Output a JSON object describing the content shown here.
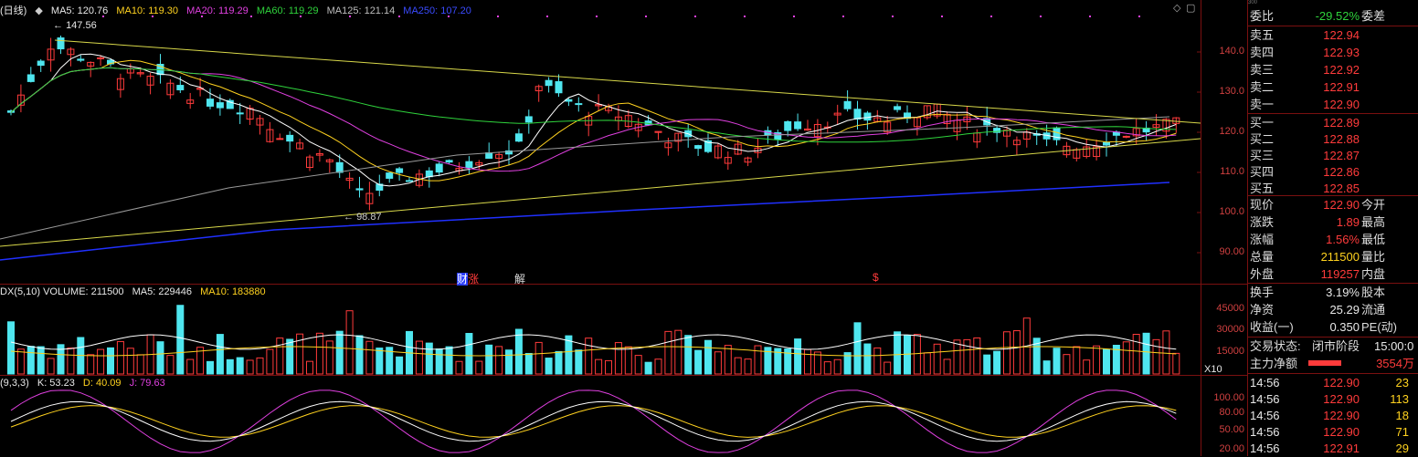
{
  "main_legend": {
    "period": "(日线)",
    "ma5": "MA5: 120.76",
    "ma10": "MA10: 119.30",
    "ma20": "MA20: 119.29",
    "ma60": "MA60: 119.29",
    "ma125": "MA125: 121.14",
    "ma250": "MA250: 107.20"
  },
  "price_axis": [
    "140.0",
    "130.0",
    "120.0",
    "110.0",
    "100.0",
    "90.00"
  ],
  "annotations": {
    "high": "147.56",
    "low": "98.87",
    "event1": "财",
    "event1b": "涨",
    "event2": "解",
    "event3": "$"
  },
  "volume_legend": {
    "name": "DX(5,10) VOLUME: 211500",
    "ma5": "MA5: 229446",
    "ma10": "MA10: 183880"
  },
  "volume_axis": [
    "45000",
    "30000",
    "15000"
  ],
  "volume_unit": "X10",
  "kdj_legend": {
    "name": "(9,3,3)",
    "k": "K: 53.23",
    "d": "D: 40.09",
    "j": "J: 79.63"
  },
  "kdj_axis": [
    "100.00",
    "80.00",
    "50.00",
    "20.00"
  ],
  "right_panel": {
    "top_code": "300",
    "weibi_label": "委比",
    "weibi_value": "-29.52%",
    "weicha_label": "委差",
    "sell": [
      {
        "label": "卖五",
        "price": "122.94"
      },
      {
        "label": "卖四",
        "price": "122.93"
      },
      {
        "label": "卖三",
        "price": "122.92"
      },
      {
        "label": "卖二",
        "price": "122.91"
      },
      {
        "label": "卖一",
        "price": "122.90"
      }
    ],
    "buy": [
      {
        "label": "买一",
        "price": "122.89"
      },
      {
        "label": "买二",
        "price": "122.88"
      },
      {
        "label": "买三",
        "price": "122.87"
      },
      {
        "label": "买四",
        "price": "122.86"
      },
      {
        "label": "买五",
        "price": "122.85"
      }
    ],
    "quote": [
      {
        "label": "现价",
        "value": "122.90",
        "label2": "今开"
      },
      {
        "label": "涨跌",
        "value": "1.89",
        "label2": "最高"
      },
      {
        "label": "涨幅",
        "value": "1.56%",
        "label2": "最低"
      },
      {
        "label": "总量",
        "value": "211500",
        "label2": "量比"
      },
      {
        "label": "外盘",
        "value": "119257",
        "label2": "内盘"
      }
    ],
    "stats": [
      {
        "label": "换手",
        "value": "3.19%",
        "label2": "股本"
      },
      {
        "label": "净资",
        "value": "25.29",
        "label2": "流通"
      },
      {
        "label": "收益(一)",
        "value": "0.350",
        "label2": "PE(动)"
      }
    ],
    "trade_status_label": "交易状态:",
    "trade_status_value": "闭市阶段",
    "trade_time": "15:00:0",
    "main_net_label": "主力净额",
    "main_net_value": "3554万",
    "ticks": [
      {
        "time": "14:56",
        "price": "122.90",
        "vol": "23"
      },
      {
        "time": "14:56",
        "price": "122.90",
        "vol": "113"
      },
      {
        "time": "14:56",
        "price": "122.90",
        "vol": "18"
      },
      {
        "time": "14:56",
        "price": "122.90",
        "vol": "71"
      },
      {
        "time": "14:56",
        "price": "122.91",
        "vol": "29"
      }
    ]
  },
  "colors": {
    "up": "#ff3b3b",
    "down": "#4fe6ef",
    "ma5": "#ffffff",
    "ma10": "#ffd21f",
    "ma20": "#e040e0",
    "ma60": "#2fd33c",
    "ma125": "#9a9a9a",
    "ma250": "#2030ff",
    "grid": "#7a1010"
  }
}
